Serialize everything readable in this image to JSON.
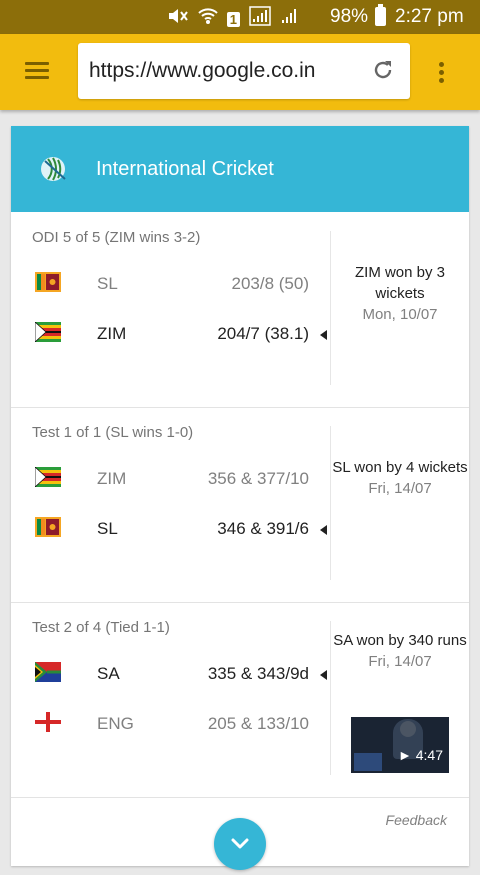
{
  "status_bar": {
    "battery": "98%",
    "time": "2:27 pm",
    "sim": "1"
  },
  "toolbar": {
    "url": "https://www.google.co.in",
    "icons": [
      "menu-icon",
      "reload-icon",
      "more-icon"
    ],
    "color": "#f2bc0e"
  },
  "card": {
    "title": "International Cricket",
    "header_color": "#35b6d6",
    "feedback": "Feedback"
  },
  "matches": [
    {
      "label": "ODI 5 of 5 (ZIM wins 3-2)",
      "teams": [
        {
          "name": "SL",
          "score": "203/8 (50)",
          "flag": "sri-lanka-flag-icon"
        },
        {
          "name": "ZIM",
          "score": "204/7 (38.1)",
          "flag": "zimbabwe-flag-icon"
        }
      ],
      "result": "ZIM won by 3 wickets",
      "date": "Mon, 10/07"
    },
    {
      "label": "Test 1 of 1 (SL wins 1-0)",
      "teams": [
        {
          "name": "ZIM",
          "score": "356 & 377/10",
          "flag": "zimbabwe-flag-icon"
        },
        {
          "name": "SL",
          "score": "346 & 391/6",
          "flag": "sri-lanka-flag-icon"
        }
      ],
      "result": "SL won by 4 wickets",
      "date": "Fri, 14/07"
    },
    {
      "label": "Test 2 of 4 (Tied 1-1)",
      "teams": [
        {
          "name": "SA",
          "score": "335 & 343/9d",
          "flag": "south-africa-flag-icon"
        },
        {
          "name": "ENG",
          "score": "205 & 133/10",
          "flag": "england-flag-icon"
        }
      ],
      "result": "SA won by 340 runs",
      "date": "Fri, 14/07",
      "video_duration": "4:47"
    }
  ]
}
